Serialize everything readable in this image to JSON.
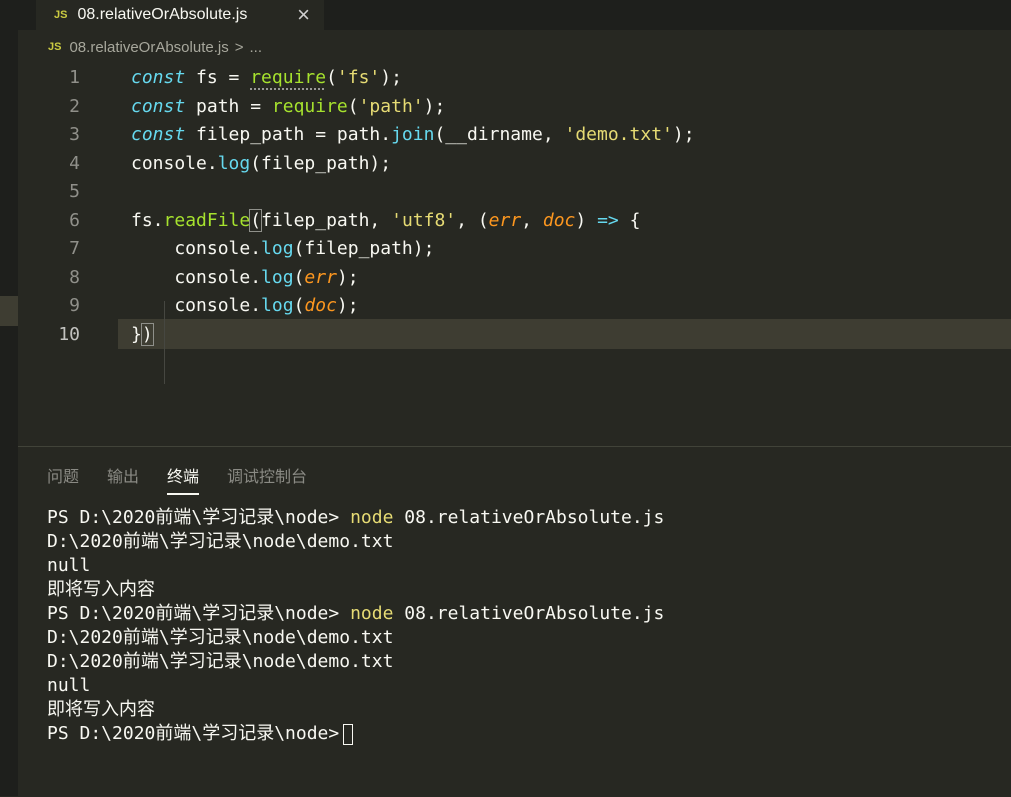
{
  "tab": {
    "badge": "JS",
    "filename": "08.relativeOrAbsolute.js",
    "close": "×"
  },
  "breadcrumb": {
    "badge": "JS",
    "file": "08.relativeOrAbsolute.js",
    "sep": ">",
    "more": "..."
  },
  "editor": {
    "line_numbers": [
      "1",
      "2",
      "3",
      "4",
      "5",
      "6",
      "7",
      "8",
      "9",
      "10"
    ],
    "active_line": 10
  },
  "panel": {
    "tabs": [
      "问题",
      "输出",
      "终端",
      "调试控制台"
    ],
    "active_tab": "终端"
  },
  "terminal": {
    "prompt1": "PS D:\\2020前端\\学习记录\\node> ",
    "cmd1_node": "node",
    "cmd1_rest": " 08.relativeOrAbsolute.js",
    "out1": "D:\\2020前端\\学习记录\\node\\demo.txt",
    "out2": "null",
    "out3": "即将写入内容",
    "prompt2": "PS D:\\2020前端\\学习记录\\node> ",
    "cmd2_node": "node",
    "cmd2_rest": " 08.relativeOrAbsolute.js",
    "out4": "D:\\2020前端\\学习记录\\node\\demo.txt",
    "out5": "D:\\2020前端\\学习记录\\node\\demo.txt",
    "out6": "null",
    "out7": "即将写入内容",
    "prompt3": "PS D:\\2020前端\\学习记录\\node>"
  },
  "colors": {
    "background": "#272822",
    "keyword": "#66d9ef",
    "string": "#e6db74",
    "function": "#a6e22e",
    "parameter": "#fd971f",
    "text": "#f8f8f2"
  }
}
